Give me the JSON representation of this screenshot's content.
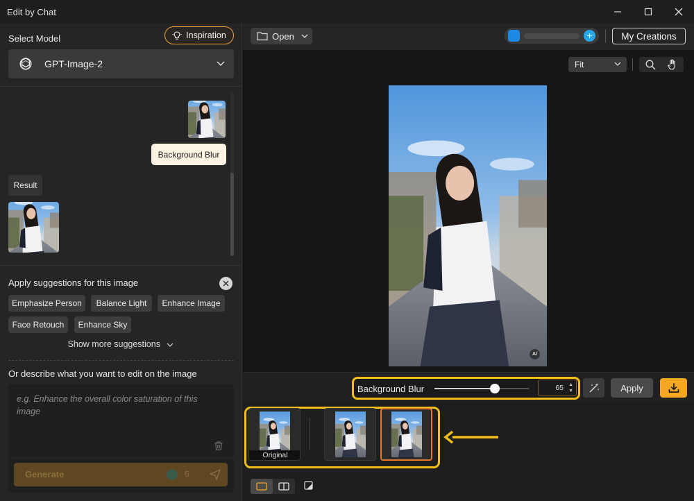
{
  "window": {
    "title": "Edit by Chat"
  },
  "left": {
    "select_model_label": "Select Model",
    "inspiration_label": "Inspiration",
    "model": {
      "name": "GPT-Image-2",
      "icon": "openai-logo-icon"
    },
    "chat": {
      "user_message": "Background Blur",
      "result_label": "Result"
    },
    "suggestions": {
      "title": "Apply suggestions for this image",
      "chips": [
        "Emphasize Person",
        "Balance Light",
        "Enhance Image",
        "Face Retouch",
        "Enhance Sky"
      ],
      "show_more": "Show more suggestions"
    },
    "describe": {
      "label": "Or describe what you want to edit on the image",
      "placeholder": "e.g. Enhance the overall color saturation of this image"
    },
    "generate": {
      "label": "Generate",
      "credits": "6"
    }
  },
  "toolbar": {
    "open_label": "Open",
    "my_creations_label": "My Creations",
    "zoom_mode": "Fit"
  },
  "canvas": {
    "ai_badge": "AI"
  },
  "adjust": {
    "label": "Background Blur",
    "value": "65",
    "slider_fraction": 0.65,
    "apply_label": "Apply"
  },
  "history": {
    "original_caption": "Original"
  },
  "colors": {
    "accent": "#f5a623",
    "highlight": "#f2be1b",
    "selected_border": "#e8782a"
  }
}
